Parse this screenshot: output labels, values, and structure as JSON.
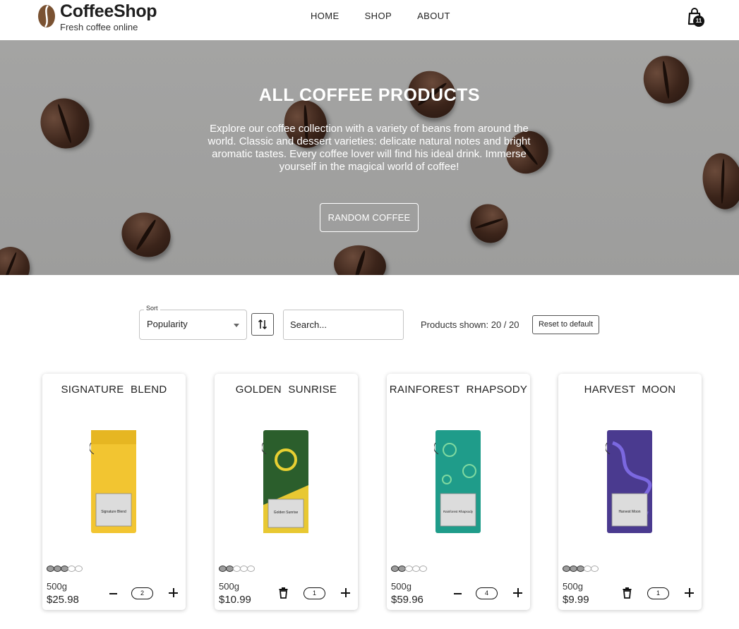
{
  "header": {
    "brand": "CoffeeShop",
    "tagline": "Fresh coffee online",
    "nav": [
      "HOME",
      "SHOP",
      "ABOUT"
    ],
    "cart_count": "11",
    "logo_icon": "coffee-bean-logo",
    "cart_icon": "shopping-bag-icon"
  },
  "hero": {
    "title": "ALL COFFEE PRODUCTS",
    "description": "Explore our coffee collection with a variety of beans from around the world. Classic and dessert varieties: delicate natural notes and bright aromatic tastes. Every coffee lover will find his ideal drink. Immerse yourself in the magical world of coffee!",
    "button": "RANDOM COFFEE"
  },
  "controls": {
    "sort_label": "Sort",
    "sort_value": "Popularity",
    "order_icon": "sort-direction-icon",
    "search_placeholder": "Search...",
    "shown_text": "Products shown: 20 / 20",
    "reset_label": "Reset to default"
  },
  "colors": {
    "hero_bg": "#a1a1a0",
    "accent_dark": "#111111",
    "yellow": "#f2c531",
    "green": "#2b5e2c",
    "teal": "#1f9c8a",
    "purple": "#4a3a8f"
  },
  "products": [
    {
      "name": "SIGNATURE BLEND",
      "weight": "500g",
      "price": "$25.98",
      "qty": "2",
      "strength": 3,
      "left_control": "minus",
      "color": "#f2c531"
    },
    {
      "name": "GOLDEN SUNRISE",
      "weight": "500g",
      "price": "$10.99",
      "qty": "1",
      "strength": 2,
      "left_control": "trash",
      "color": "#2b5e2c"
    },
    {
      "name": "RAINFOREST RHAPSODY",
      "weight": "500g",
      "price": "$59.96",
      "qty": "4",
      "strength": 2,
      "left_control": "minus",
      "color": "#1f9c8a"
    },
    {
      "name": "HARVEST MOON",
      "weight": "500g",
      "price": "$9.99",
      "qty": "1",
      "strength": 3,
      "left_control": "trash",
      "color": "#4a3a8f"
    }
  ]
}
